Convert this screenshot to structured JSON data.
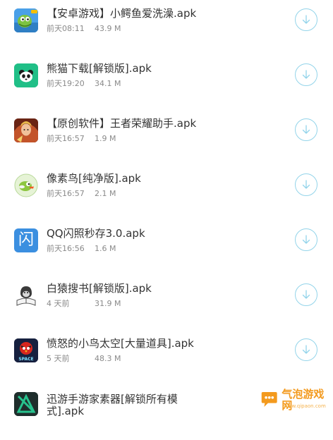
{
  "files": [
    {
      "title": "【安卓游戏】小鳄鱼爱洗澡.apk",
      "time": "前天08:11",
      "size": "43.9 M",
      "icon": "crocodile-game-icon"
    },
    {
      "title": "熊猫下载[解锁版].apk",
      "time": "前天19:20",
      "size": "34.1 M",
      "icon": "panda-icon"
    },
    {
      "title": "【原创软件】王者荣耀助手.apk",
      "time": "前天16:57",
      "size": "1.9 M",
      "icon": "hero-game-icon"
    },
    {
      "title": "像素鸟[纯净版].apk",
      "time": "前天16:57",
      "size": "2.1 M",
      "icon": "pixel-bird-icon"
    },
    {
      "title": "QQ闪照秒存3.0.apk",
      "time": "前天16:56",
      "size": "1.6 M",
      "icon": "flash-icon"
    },
    {
      "title": "白猿搜书[解锁版].apk",
      "time": "4 天前",
      "size": "31.9 M",
      "icon": "ape-reading-icon"
    },
    {
      "title": "愤怒的小鸟太空[大量道具].apk",
      "time": "5 天前",
      "size": "48.3 M",
      "icon": "angry-birds-space-icon"
    },
    {
      "title": "迅游手游家素器[解锁所有模式].apk",
      "time": "",
      "size": "",
      "icon": "xunyou-icon"
    }
  ],
  "icon_labels": {
    "flash": "闪",
    "angry_birds": "SPACE"
  },
  "watermark": {
    "text": "气泡游戏网",
    "sub": "www.qipaon.com"
  },
  "colors": {
    "download_ring": "#93d4ea",
    "title_text": "#333333",
    "meta_text": "#8a8a8a",
    "watermark": "#f39a1e"
  }
}
